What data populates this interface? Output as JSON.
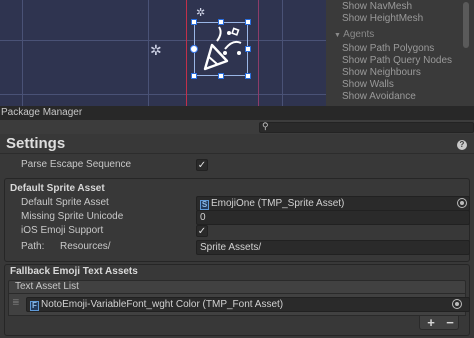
{
  "gizmos": {
    "items": [
      {
        "label": "Show NavMesh"
      },
      {
        "label": "Show HeightMesh"
      },
      {
        "label": "Show Path Polygons"
      },
      {
        "label": "Show Path Query Nodes"
      },
      {
        "label": "Show Neighbours"
      },
      {
        "label": "Show Walls"
      },
      {
        "label": "Show Avoidance"
      }
    ],
    "agents_header": "Agents"
  },
  "window": {
    "title": "Package Manager"
  },
  "settings": {
    "title": "Settings",
    "parse_escape_label": "Parse Escape Sequence",
    "parse_escape_checked": "✓"
  },
  "default_sprite": {
    "section": "Default Sprite Asset",
    "asset_label": "Default Sprite Asset",
    "asset_value": "EmojiOne (TMP_Sprite Asset)",
    "missing_label": "Missing Sprite Unicode",
    "missing_value": "0",
    "ios_label": "iOS Emoji Support",
    "ios_checked": "✓",
    "path_label": "Path:",
    "path_prefix": "Resources/",
    "path_value": "Sprite Assets/"
  },
  "fallback": {
    "section": "Fallback Emoji Text Assets",
    "list_label": "Text Asset List",
    "item_value": "NotoEmoji-VariableFont_wght Color (TMP_Font Asset)",
    "add": "+",
    "remove": "−"
  },
  "icons": {
    "party": "party-popper-icon",
    "sprite_asset": "S",
    "font_asset": "F",
    "help": "?",
    "search": "search-icon"
  }
}
